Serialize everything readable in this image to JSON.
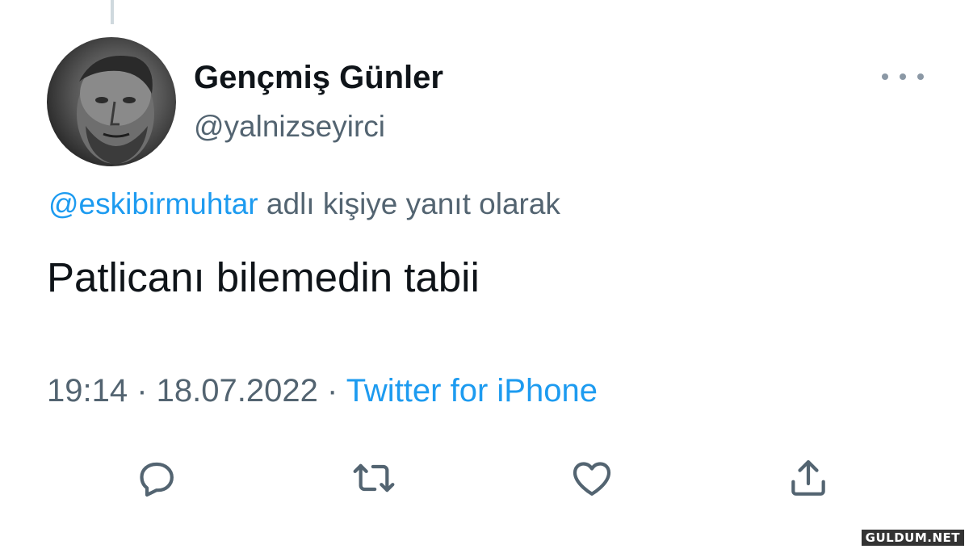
{
  "tweet": {
    "author": {
      "display_name": "Gençmiş Günler",
      "handle": "@yalnizseyirci"
    },
    "reply_to": {
      "mention": "@eskibirmuhtar",
      "suffix": " adlı kişiye yanıt olarak"
    },
    "text": "Patlicanı bilemedin tabii",
    "meta": {
      "time": "19:14",
      "separator": " · ",
      "date": "18.07.2022",
      "source": "Twitter for iPhone"
    },
    "actions": {
      "icons": [
        "reply-icon",
        "retweet-icon",
        "like-icon",
        "share-icon"
      ]
    }
  },
  "watermark": "GULDUM.NET",
  "colors": {
    "text_primary": "#0f1419",
    "text_secondary": "#536471",
    "link": "#1d9bf0",
    "icon": "#536471"
  }
}
